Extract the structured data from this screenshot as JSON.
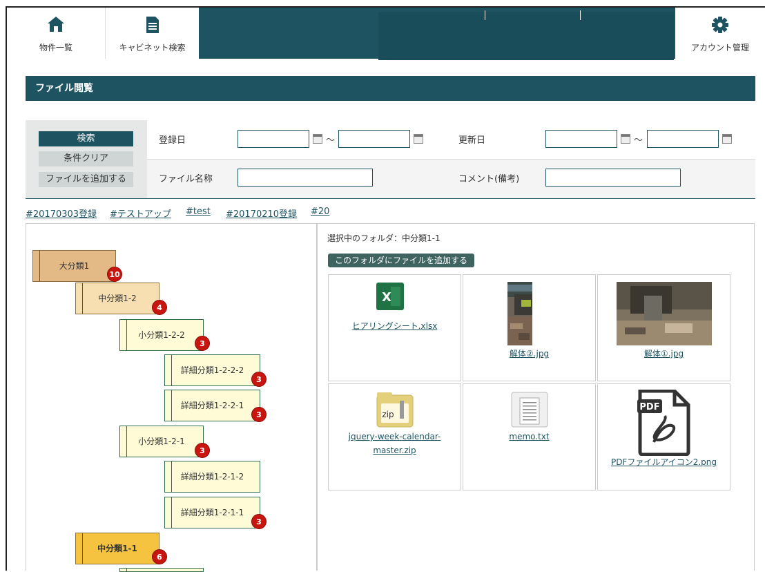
{
  "nav": {
    "tabs": [
      {
        "label": "物件一覧",
        "icon": "home-icon"
      },
      {
        "label": "キャビネット検索",
        "icon": "document-icon"
      },
      {
        "label": "アカウント管理",
        "icon": "gear-icon"
      }
    ]
  },
  "section_title": "ファイル閲覧",
  "search": {
    "buttons": {
      "search": "検索",
      "clear": "条件クリア",
      "add_file": "ファイルを追加する"
    },
    "labels": {
      "registered": "登録日",
      "updated": "更新日",
      "filename": "ファイル名称",
      "comment": "コメント(備考)"
    },
    "tilde": "～",
    "values": {
      "reg_from": "",
      "reg_to": "",
      "upd_from": "",
      "upd_to": "",
      "filename": "",
      "comment": ""
    }
  },
  "tags": [
    "#20170303登録",
    "#テストアップ",
    "#test",
    "#20170210登録",
    "#20"
  ],
  "tree": {
    "nodes": [
      {
        "label": "大分類1",
        "count": "10"
      },
      {
        "label": "中分類1-2",
        "count": "4"
      },
      {
        "label": "小分類1-2-2",
        "count": "3"
      },
      {
        "label": "詳細分類1-2-2-2",
        "count": "3"
      },
      {
        "label": "詳細分類1-2-2-1",
        "count": "3"
      },
      {
        "label": "小分類1-2-1",
        "count": "3"
      },
      {
        "label": "詳細分類1-2-1-2",
        "count": ""
      },
      {
        "label": "詳細分類1-2-1-1",
        "count": "3"
      },
      {
        "label": "中分類1-1",
        "count": "6"
      }
    ]
  },
  "files": {
    "selected_folder_text": "選択中のフォルダ：中分類1-1",
    "add_button": "このフォルダにファイルを追加する",
    "items": [
      {
        "name": "ヒアリングシート.xlsx",
        "icon": "excel-icon"
      },
      {
        "name": "解体②.jpg",
        "icon": "photo-thumbnail"
      },
      {
        "name": "解体①.jpg",
        "icon": "photo-thumbnail"
      },
      {
        "name": "jquery-week-calendar-master.zip",
        "icon": "zip-icon"
      },
      {
        "name": "memo.txt",
        "icon": "text-file-icon"
      },
      {
        "name": "PDFファイルアイコン2.png",
        "icon": "pdf-icon"
      }
    ],
    "excel_letter": "X",
    "zip_label": "zip",
    "pdf_label": "PDF"
  },
  "colors": {
    "primary": "#1e5462",
    "badge": "#c8150f",
    "selected_node": "#f5c33f"
  }
}
